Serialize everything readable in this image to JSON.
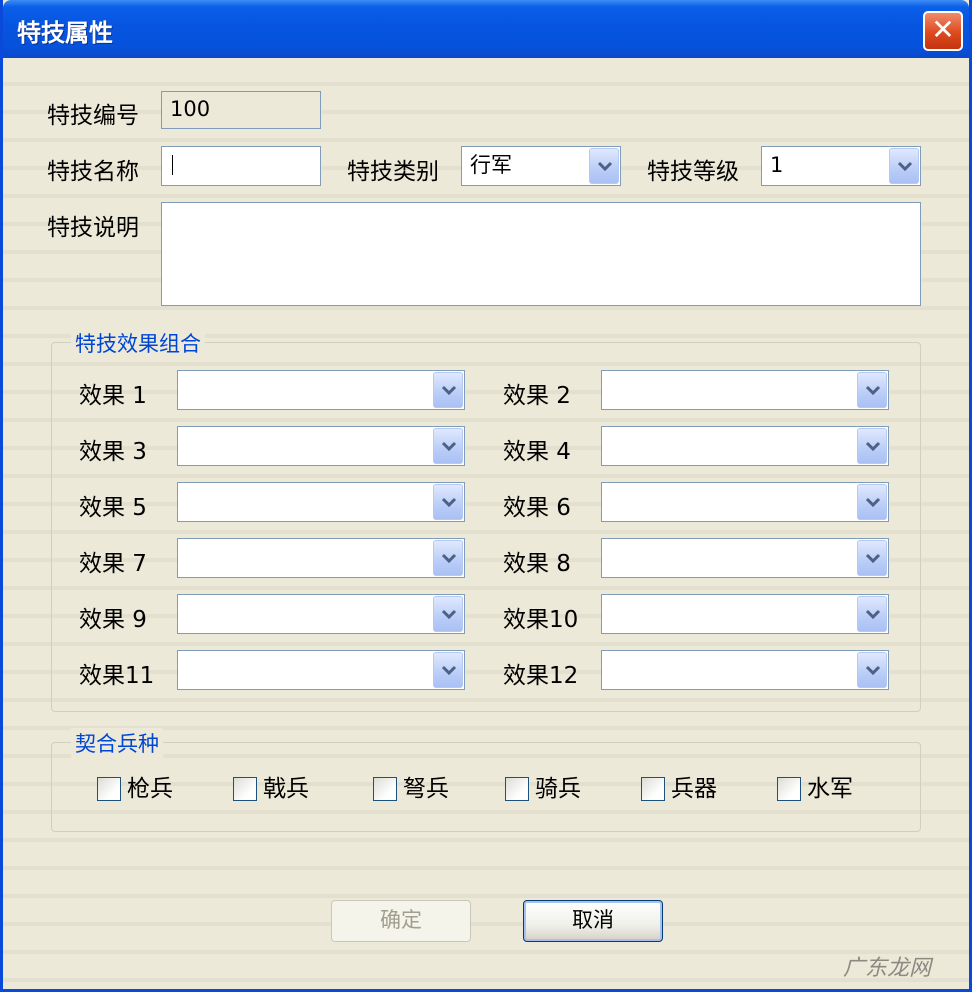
{
  "window": {
    "title": "特技属性",
    "close_glyph": "✕"
  },
  "fields": {
    "id_label": "特技编号",
    "id_value": "100",
    "name_label": "特技名称",
    "name_value": "",
    "category_label": "特技类别",
    "category_value": "行军",
    "level_label": "特技等级",
    "level_value": "1",
    "desc_label": "特技说明",
    "desc_value": ""
  },
  "effects_group": {
    "title": "特技效果组合",
    "items": [
      {
        "label": "效果 1",
        "value": ""
      },
      {
        "label": "效果 2",
        "value": ""
      },
      {
        "label": "效果 3",
        "value": ""
      },
      {
        "label": "效果 4",
        "value": ""
      },
      {
        "label": "效果 5",
        "value": ""
      },
      {
        "label": "效果 6",
        "value": ""
      },
      {
        "label": "效果 7",
        "value": ""
      },
      {
        "label": "效果 8",
        "value": ""
      },
      {
        "label": "效果 9",
        "value": ""
      },
      {
        "label": "效果10",
        "value": ""
      },
      {
        "label": "效果11",
        "value": ""
      },
      {
        "label": "效果12",
        "value": ""
      }
    ]
  },
  "troops_group": {
    "title": "契合兵种",
    "items": [
      {
        "label": "枪兵",
        "checked": false
      },
      {
        "label": "戟兵",
        "checked": false
      },
      {
        "label": "弩兵",
        "checked": false
      },
      {
        "label": "骑兵",
        "checked": false
      },
      {
        "label": "兵器",
        "checked": false
      },
      {
        "label": "水军",
        "checked": false
      }
    ]
  },
  "buttons": {
    "ok": "确定",
    "cancel": "取消"
  },
  "watermark": "广东龙网",
  "icons": {
    "dropdown": "chevron-down-icon",
    "close": "close-icon"
  },
  "colors": {
    "titlebar": "#0754e0",
    "group_title": "#0046d5",
    "close_button": "#de4a1e",
    "dialog_bg": "#ece9d8"
  }
}
